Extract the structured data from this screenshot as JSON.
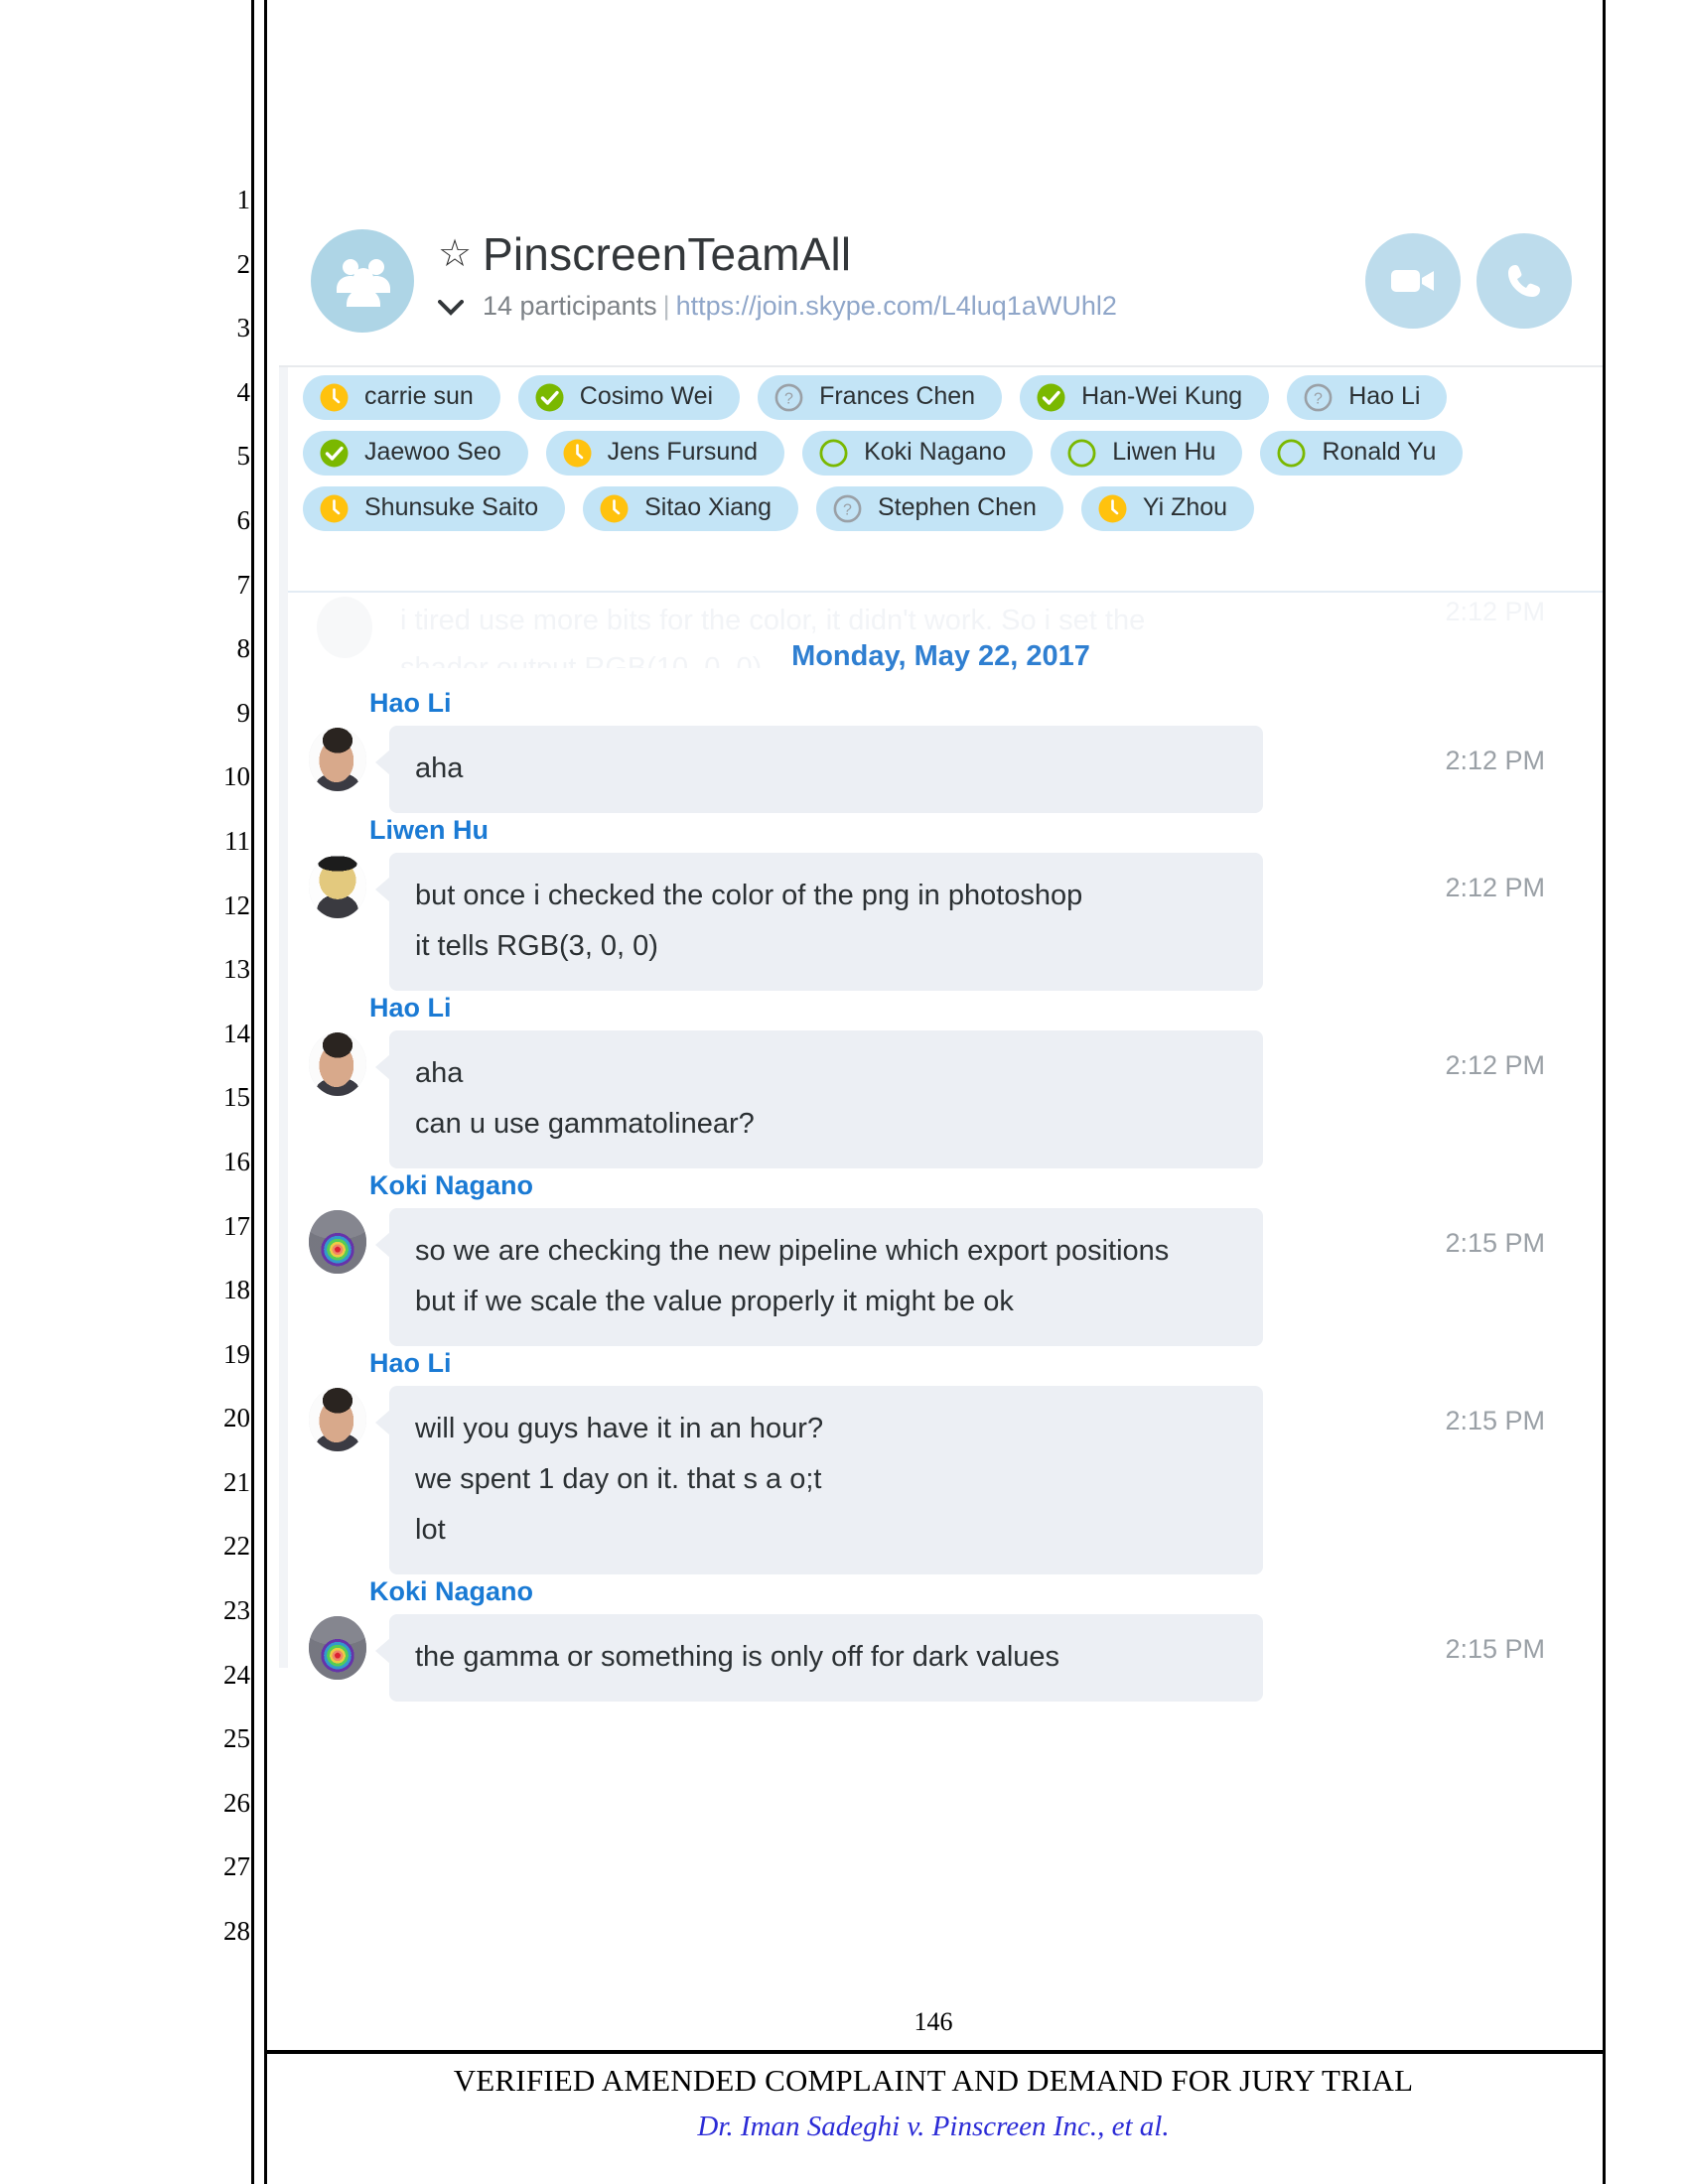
{
  "legal": {
    "line_numbers": [
      "1",
      "2",
      "3",
      "4",
      "5",
      "6",
      "7",
      "8",
      "9",
      "10",
      "11",
      "12",
      "13",
      "14",
      "15",
      "16",
      "17",
      "18",
      "19",
      "20",
      "21",
      "22",
      "23",
      "24",
      "25",
      "26",
      "27",
      "28"
    ],
    "page_number": "146",
    "footer_title": "VERIFIED AMENDED COMPLAINT AND DEMAND FOR JURY TRIAL",
    "footer_case": "Dr. Iman Sadeghi v. Pinscreen Inc., et al."
  },
  "header": {
    "title": "PinscreenTeamAll",
    "participants_count": "14 participants",
    "separator": "|",
    "join_url": "https://join.skype.com/L4luq1aWUhl2",
    "star_glyph": "☆",
    "chevron_glyph": "⌄",
    "video_call_label": "video-call",
    "audio_call_label": "audio-call"
  },
  "participants": [
    [
      {
        "name": "carrie sun",
        "status": "away"
      },
      {
        "name": "Cosimo Wei",
        "status": "online"
      },
      {
        "name": "Frances Chen",
        "status": "unknown"
      },
      {
        "name": "Han-Wei Kung",
        "status": "online"
      },
      {
        "name": "Hao Li",
        "status": "unknown"
      }
    ],
    [
      {
        "name": "Jaewoo Seo",
        "status": "online"
      },
      {
        "name": "Jens Fursund",
        "status": "away"
      },
      {
        "name": "Koki Nagano",
        "status": "offline"
      },
      {
        "name": "Liwen Hu",
        "status": "offline"
      },
      {
        "name": "Ronald Yu",
        "status": "offline"
      }
    ],
    [
      {
        "name": "Shunsuke Saito",
        "status": "away"
      },
      {
        "name": "Sitao Xiang",
        "status": "away"
      },
      {
        "name": "Stephen Chen",
        "status": "unknown"
      },
      {
        "name": "Yi Zhou",
        "status": "away"
      }
    ]
  ],
  "faded_message": {
    "text": "i tired use more bits for the color, it didn't work. So i set the\nshader output RGB(10, 0, 0)",
    "time": "2:12 PM"
  },
  "date_divider": "Monday, May 22, 2017",
  "messages": [
    {
      "sender": "Hao Li",
      "avatar": "hao",
      "time": "2:12 PM",
      "lines": [
        "aha"
      ]
    },
    {
      "sender": "Liwen Hu",
      "avatar": "liwen",
      "time": "2:12 PM",
      "lines": [
        "but once i checked the color of the png in photoshop",
        "it tells RGB(3, 0, 0)"
      ]
    },
    {
      "sender": "Hao Li",
      "avatar": "hao",
      "time": "2:12 PM",
      "lines": [
        "aha",
        "can u use gammatolinear?"
      ]
    },
    {
      "sender": "Koki Nagano",
      "avatar": "koki",
      "time": "2:15 PM",
      "lines": [
        "so we are checking the new pipeline which export positions",
        "but if we scale the value properly it might be ok"
      ]
    },
    {
      "sender": "Hao Li",
      "avatar": "hao",
      "time": "2:15 PM",
      "lines": [
        "will you guys have it in an hour?",
        "we spent 1 day on it. that s a o;t",
        "lot"
      ]
    },
    {
      "sender": "Koki Nagano",
      "avatar": "koki",
      "time": "2:15 PM",
      "lines": [
        "the gamma or something is only off for dark values"
      ]
    }
  ],
  "colors": {
    "chip_bg": "#c3e4f6",
    "bubble_bg": "#eceff4",
    "sender_name": "#1a7ad4",
    "date_divider": "#2f7fd1",
    "avatar_bg": "#aed5e6",
    "status_online": "#7ab800",
    "status_away": "#ffc20e",
    "status_unknown": "#9aa0a6",
    "status_offline": "#7ab800"
  }
}
